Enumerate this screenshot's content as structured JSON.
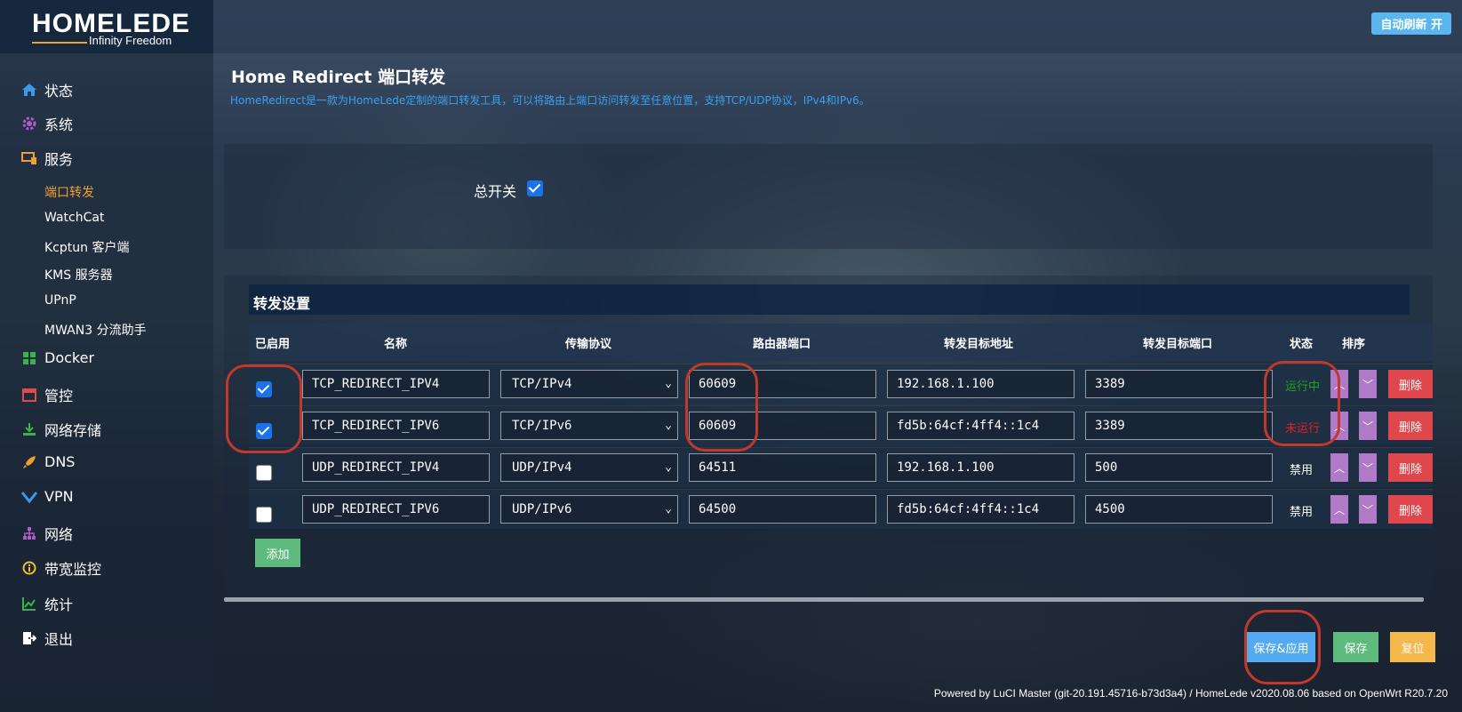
{
  "header": {
    "logo_text": "HOMELEDE",
    "logo_tagline": "Infinity Freedom",
    "auto_refresh": "自动刷新 开"
  },
  "sidebar": {
    "items": [
      {
        "label": "状态",
        "icon": "home-icon"
      },
      {
        "label": "系统",
        "icon": "gear-icon"
      },
      {
        "label": "服务",
        "icon": "services-icon"
      },
      {
        "label": "Docker",
        "icon": "grid-icon"
      },
      {
        "label": "管控",
        "icon": "calendar-icon"
      },
      {
        "label": "网络存储",
        "icon": "download-icon"
      },
      {
        "label": "DNS",
        "icon": "rocket-icon"
      },
      {
        "label": "VPN",
        "icon": "vpn-icon"
      },
      {
        "label": "网络",
        "icon": "network-icon"
      },
      {
        "label": "带宽监控",
        "icon": "info-icon"
      },
      {
        "label": "统计",
        "icon": "chart-icon"
      },
      {
        "label": "退出",
        "icon": "logout-icon"
      }
    ],
    "sub_items": [
      {
        "label": "端口转发",
        "active": true
      },
      {
        "label": "WatchCat",
        "active": false
      },
      {
        "label": "Kcptun 客户端",
        "active": false
      },
      {
        "label": "KMS 服务器",
        "active": false
      },
      {
        "label": "UPnP",
        "active": false
      },
      {
        "label": "MWAN3 分流助手",
        "active": false
      }
    ]
  },
  "page": {
    "title": "Home Redirect 端口转发",
    "description": "HomeRedirect是一款为HomeLede定制的端口转发工具，可以将路由上端口访问转发至任意位置，支持TCP/UDP协议，IPv4和IPv6。",
    "master_switch_label": "总开关",
    "master_switch_checked": true
  },
  "section": {
    "title": "转发设置",
    "columns": [
      "已启用",
      "名称",
      "传输协议",
      "路由器端口",
      "转发目标地址",
      "转发目标端口",
      "状态",
      "排序"
    ],
    "rows": [
      {
        "enabled": true,
        "name": "TCP_REDIRECT_IPV4",
        "protocol": "TCP/IPv4",
        "router_port": "60609",
        "target_addr": "192.168.1.100",
        "target_port": "3389",
        "status": "运行中",
        "status_kind": "running",
        "delete": "删除"
      },
      {
        "enabled": true,
        "name": "TCP_REDIRECT_IPV6",
        "protocol": "TCP/IPv6",
        "router_port": "60609",
        "target_addr": "fd5b:64cf:4ff4::1c4",
        "target_port": "3389",
        "status": "未运行",
        "status_kind": "stopped",
        "delete": "删除"
      },
      {
        "enabled": false,
        "name": "UDP_REDIRECT_IPV4",
        "protocol": "UDP/IPv4",
        "router_port": "64511",
        "target_addr": "192.168.1.100",
        "target_port": "500",
        "status": "禁用",
        "status_kind": "disabled",
        "delete": "删除"
      },
      {
        "enabled": false,
        "name": "UDP_REDIRECT_IPV6",
        "protocol": "UDP/IPv6",
        "router_port": "64500",
        "target_addr": "fd5b:64cf:4ff4::1c4",
        "target_port": "4500",
        "status": "禁用",
        "status_kind": "disabled",
        "delete": "删除"
      }
    ],
    "add_button": "添加"
  },
  "actions": {
    "save_apply": "保存&应用",
    "save": "保存",
    "reset": "复位"
  },
  "footer": "Powered by LuCI Master (git-20.191.45716-b73d3a4) / HomeLede v2020.08.06 based on OpenWrt R20.7.20",
  "colors": {
    "accent_orange": "#f0a030",
    "link_blue": "#3aa0f0",
    "running_green": "#21a121",
    "stopped_red": "#e02020",
    "annotation_red": "#c0392b"
  }
}
